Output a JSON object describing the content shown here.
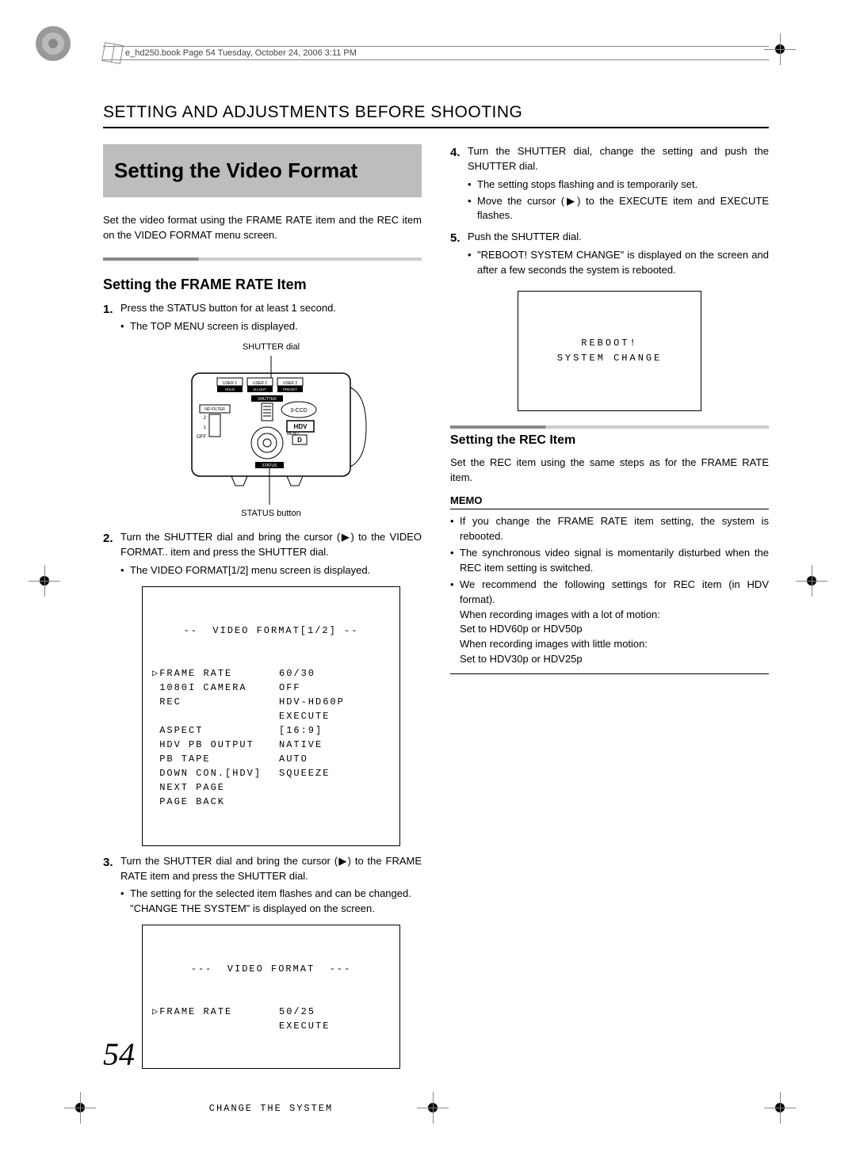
{
  "book_line": "e_hd250.book  Page 54  Tuesday, October 24, 2006  3:11 PM",
  "section_header": "SETTING AND ADJUSTMENTS BEFORE SHOOTING",
  "title": "Setting the Video Format",
  "intro": "Set the video format using the FRAME RATE item and the REC item on the VIDEO FORMAT menu screen.",
  "sub1": "Setting the FRAME RATE Item",
  "steps_left": {
    "s1": "Press the STATUS button for at least 1 second.",
    "s1b1": "The TOP MENU screen is displayed.",
    "s2": "Turn the SHUTTER dial and bring the cursor (▶) to the VIDEO FORMAT.. item and press the SHUTTER dial.",
    "s2b1": "The VIDEO FORMAT[1/2] menu screen is displayed.",
    "s3": "Turn the SHUTTER dial and bring the cursor (▶) to the FRAME RATE item and press the SHUTTER dial.",
    "s3b1": "The setting for the selected item flashes and can be changed.",
    "s3b2": "\"CHANGE THE SYSTEM\" is displayed on the screen."
  },
  "diagram_labels": {
    "top": "SHUTTER dial",
    "bottom": "STATUS button"
  },
  "menu1": {
    "title": "--  VIDEO FORMAT[1/2] --",
    "rows": [
      {
        "k": "FRAME RATE",
        "v": "60/30",
        "cursor": true
      },
      {
        "k": " 1080I CAMERA",
        "v": "OFF"
      },
      {
        "k": " REC",
        "v": "HDV-HD60P"
      },
      {
        "k": "",
        "v": "EXECUTE"
      },
      {
        "k": " ASPECT",
        "v": "[16:9]"
      },
      {
        "k": " HDV PB OUTPUT",
        "v": "NATIVE"
      },
      {
        "k": " PB TAPE",
        "v": "AUTO"
      },
      {
        "k": " DOWN CON.[HDV]",
        "v": "SQUEEZE"
      },
      {
        "k": " NEXT PAGE",
        "v": ""
      },
      {
        "k": " PAGE BACK",
        "v": ""
      }
    ]
  },
  "menu2": {
    "title": "---  VIDEO FORMAT  ---",
    "rows": [
      {
        "k": "FRAME RATE",
        "v": "50/25",
        "cursor": true
      },
      {
        "k": "",
        "v": "EXECUTE"
      }
    ],
    "msg": "CHANGE THE SYSTEM"
  },
  "steps_right": {
    "s4": "Turn the SHUTTER dial, change the setting and push the SHUTTER dial.",
    "s4b1": "The setting stops flashing and is temporarily set.",
    "s4b2": "Move the cursor (▶) to the EXECUTE item and EXECUTE flashes.",
    "s5": "Push the SHUTTER dial.",
    "s5b1": "\"REBOOT! SYSTEM CHANGE\" is displayed on the screen and after a few seconds the system is rebooted."
  },
  "reboot1": "REBOOT!",
  "reboot2": "SYSTEM CHANGE",
  "sub2": "Setting the REC Item",
  "rec_intro": "Set the REC item using the same steps as for the FRAME RATE item.",
  "memo_head": "MEMO",
  "memo": {
    "m1": "If you change the FRAME RATE item setting, the system is rebooted.",
    "m2": "The synchronous video signal is momentarily disturbed when the REC item setting is switched.",
    "m3": "We recommend the following settings for REC item (in HDV format).",
    "m3a": "When recording images with a lot of motion:",
    "m3b": "Set to HDV60p or HDV50p",
    "m3c": "When recording images with little motion:",
    "m3d": "Set to HDV30p or HDV25p"
  },
  "cam_labels": {
    "user1_sub": "HOLD",
    "user2_sub": "B.LGHT",
    "user3_sub": "PRESET",
    "shutter": "SHUTTER",
    "ndfilter": "ND FILTER",
    "menu": "MENU",
    "status": "STATUS",
    "hdv": "HDV"
  },
  "page_num": "54"
}
